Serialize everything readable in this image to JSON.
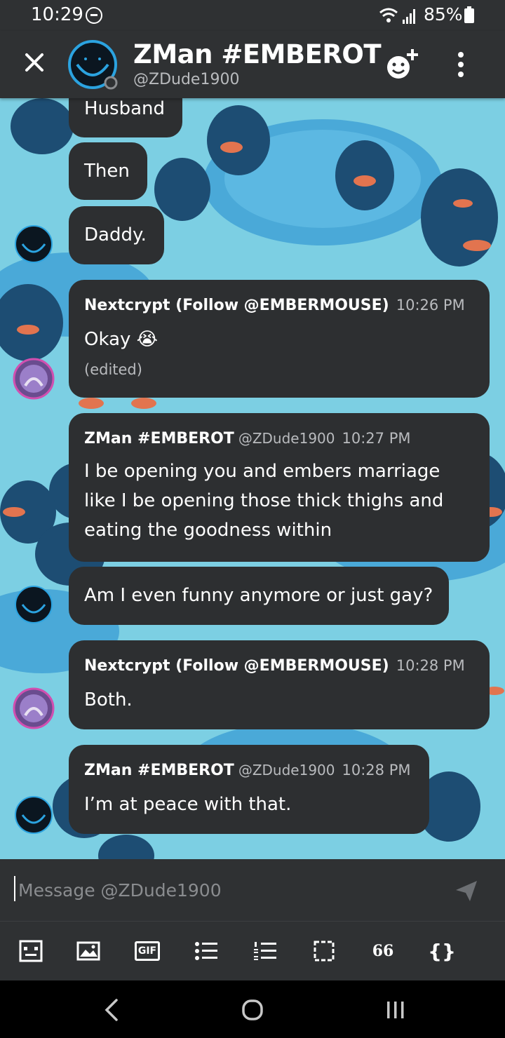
{
  "status_bar": {
    "time": "10:29",
    "battery": "85%"
  },
  "header": {
    "title": "ZMan #EMBEROT",
    "subtitle": "@ZDude1900",
    "icons": [
      "close-icon",
      "add-friend-icon",
      "more-vertical-icon"
    ]
  },
  "messages": [
    {
      "text": "Husband"
    },
    {
      "text": "Then"
    },
    {
      "text": "Daddy."
    },
    {
      "author": "Nextcrypt (Follow @EMBERMOUSE)",
      "time": "10:26 PM",
      "text": "Okay 😭",
      "edited": "(edited)"
    },
    {
      "author": "ZMan #EMBEROT",
      "handle": "@ZDude1900",
      "time": "10:27 PM",
      "lines": [
        "I be opening you and embers marriage",
        "like I be opening those thick thighs and",
        "eating the goodness within"
      ]
    },
    {
      "text": "Am I even funny anymore or just gay?"
    },
    {
      "author": "Nextcrypt (Follow @EMBERMOUSE)",
      "time": "10:28 PM",
      "text": "Both."
    },
    {
      "author": "ZMan #EMBEROT",
      "handle": "@ZDude1900",
      "time": "10:28 PM",
      "text": "I’m at peace with that."
    }
  ],
  "composer": {
    "placeholder": "Message @ZDude1900",
    "tools": [
      "attach-icon",
      "image-icon",
      "gif-icon",
      "bullet-list-icon",
      "numbered-list-icon",
      "spoiler-icon",
      "quote-icon",
      "code-block-icon"
    ],
    "gif_label": "GIF",
    "quote_label": "66",
    "code_label": "{}"
  },
  "colors": {
    "bubble": "#2d2f31",
    "chrome": "#2f3133",
    "accent": "#2ba3e0",
    "background": "#7ccfe3"
  }
}
